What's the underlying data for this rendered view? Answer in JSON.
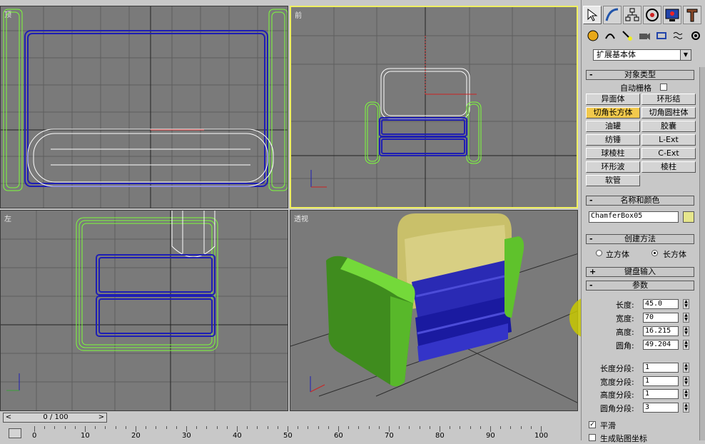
{
  "viewports": {
    "top": {
      "label": "顶"
    },
    "front": {
      "label": "前"
    },
    "left": {
      "label": "左"
    },
    "perspective": {
      "label": "透视"
    }
  },
  "panel": {
    "tabs": [
      "create-tab",
      "modify-tab",
      "hierarchy-tab",
      "motion-tab",
      "display-tab",
      "utilities-tab"
    ],
    "category_dropdown": "扩展基本体",
    "object_type": {
      "title": "对象类型",
      "autogrid_label": "自动栅格",
      "buttons": [
        [
          "异面体",
          "环形结"
        ],
        [
          "切角长方体",
          "切角圆柱体"
        ],
        [
          "油罐",
          "胶囊"
        ],
        [
          "纺锤",
          "L-Ext"
        ],
        [
          "球棱柱",
          "C-Ext"
        ],
        [
          "环形波",
          "棱柱"
        ],
        [
          "软管",
          ""
        ]
      ],
      "active_button": "切角长方体"
    },
    "name_color": {
      "title": "名称和颜色",
      "name_value": "ChamferBox05",
      "color": "#e6e68c"
    },
    "creation_method": {
      "title": "创建方法",
      "option_cube": "立方体",
      "option_box": "长方体"
    },
    "keyboard_entry": {
      "title": "键盘输入"
    },
    "parameters": {
      "title": "参数",
      "length_label": "长度:",
      "length_value": "45.0",
      "width_label": "宽度:",
      "width_value": "70",
      "height_label": "高度:",
      "height_value": "16.215",
      "fillet_label": "圆角:",
      "fillet_value": "49.204",
      "length_segs_label": "长度分段:",
      "length_segs_value": "1",
      "width_segs_label": "宽度分段:",
      "width_segs_value": "1",
      "height_segs_label": "高度分段:",
      "height_segs_value": "1",
      "fillet_segs_label": "圆角分段:",
      "fillet_segs_value": "3",
      "smooth_label": "平滑",
      "gen_map_label": "生成贴图坐标"
    }
  },
  "timeline": {
    "slider_text": "0 / 100",
    "ticks": [
      "0",
      "10",
      "20",
      "30",
      "40",
      "50",
      "60",
      "70",
      "80",
      "90",
      "100"
    ]
  },
  "colors": {
    "viewport_bg": "#7a7a7a",
    "active_border": "#f0f060",
    "green_wire": "#7dff3a",
    "blue_wire": "#1e1eb4",
    "white_wire": "#ffffff"
  }
}
